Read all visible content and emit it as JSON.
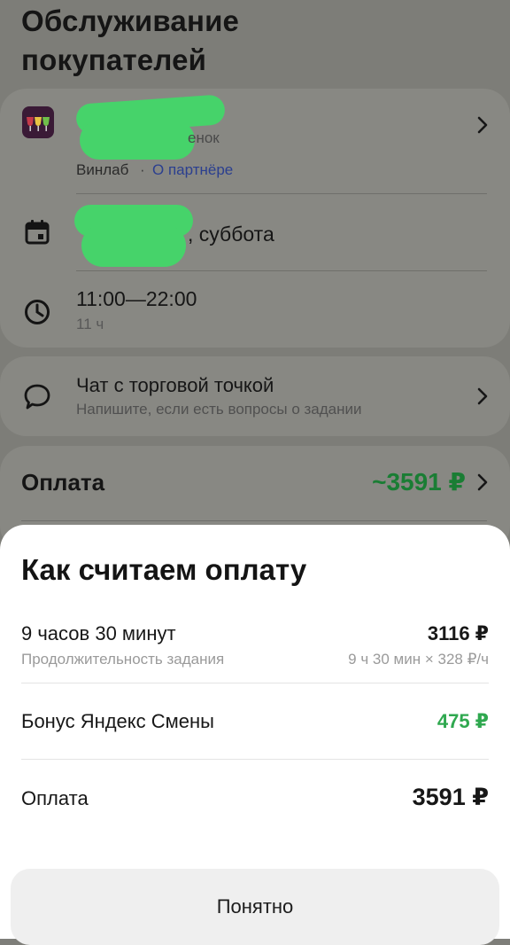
{
  "page": {
    "title_line1": "Обслуживание",
    "title_line2": "покупателей"
  },
  "partner": {
    "name_partial": "енок",
    "brand": "Винлаб",
    "separator": "·",
    "about_link": "О партнёре"
  },
  "date": {
    "day_suffix": ", суббота"
  },
  "time": {
    "range": "11:00—22:00",
    "duration": "11 ч"
  },
  "chat": {
    "title": "Чат с торговой точкой",
    "subtitle": "Напишите, если есть вопросы о задании"
  },
  "payment_row": {
    "label": "Оплата",
    "amount": "~3591 ₽"
  },
  "sheet": {
    "title": "Как считаем оплату",
    "rows": [
      {
        "title": "9 часов 30 минут",
        "subtitle": "Продолжительность задания",
        "value": "3116 ₽",
        "value_sub": "9 ч 30 мин × 328 ₽/ч"
      },
      {
        "title": "Бонус Яндекс Смены",
        "value": "475 ₽"
      },
      {
        "title": "Оплата",
        "value": "3591 ₽"
      }
    ],
    "button": "Понятно"
  },
  "colors": {
    "accent_green": "#2fa84f",
    "overlay": "#7e7e79",
    "sheet_bg": "#ffffff",
    "button_bg": "#efefef"
  },
  "icons": {
    "partner": "winelab-logo-icon",
    "date": "calendar-icon",
    "time": "clock-icon",
    "chat": "chat-bubble-icon",
    "chevron": "chevron-right-icon"
  }
}
